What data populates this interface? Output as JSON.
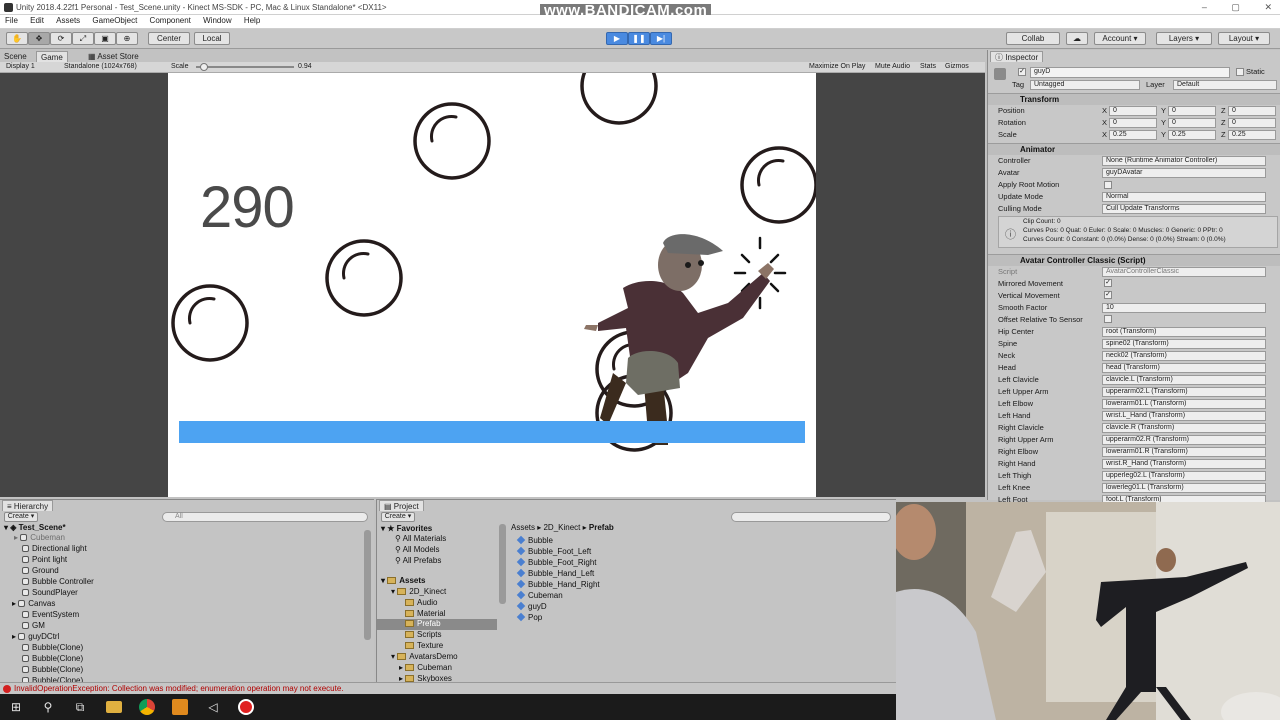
{
  "window": {
    "title": "Unity 2018.4.22f1 Personal - Test_Scene.unity - Kinect MS-SDK - PC, Mac & Linux Standalone* <DX11>",
    "watermark": "www.BANDICAM.com",
    "controls": [
      "–",
      "▢",
      "✕"
    ]
  },
  "menu": [
    "File",
    "Edit",
    "Assets",
    "GameObject",
    "Component",
    "Window",
    "Help"
  ],
  "toolbar": {
    "pivot": "Center",
    "space": "Local",
    "collab": "Collab",
    "account": "Account",
    "layers": "Layers",
    "layout": "Layout"
  },
  "tabs": {
    "scene": "Scene",
    "game": "Game",
    "asset_store": "Asset Store",
    "inspector": "Inspector",
    "hierarchy": "Hierarchy",
    "project": "Project"
  },
  "game_bar": {
    "display": "Display 1",
    "resolution": "Standalone (1024x768)",
    "scale_label": "Scale",
    "scale_value": "0.94",
    "maximize": "Maximize On Play",
    "mute": "Mute Audio",
    "stats": "Stats",
    "gizmos": "Gizmos"
  },
  "game": {
    "score": "290"
  },
  "inspector": {
    "object_name": "guyD",
    "static_label": "Static",
    "tag_label": "Tag",
    "tag_value": "Untagged",
    "layer_label": "Layer",
    "layer_value": "Default",
    "transform": {
      "title": "Transform",
      "rows": [
        {
          "label": "Position",
          "x": "0",
          "y": "0",
          "z": "0"
        },
        {
          "label": "Rotation",
          "x": "0",
          "y": "0",
          "z": "0"
        },
        {
          "label": "Scale",
          "x": "0.25",
          "y": "0.25",
          "z": "0.25"
        }
      ]
    },
    "animator": {
      "title": "Animator",
      "rows": [
        {
          "label": "Controller",
          "value": "None (Runtime Animator Controller)"
        },
        {
          "label": "Avatar",
          "value": "guyDAvatar"
        },
        {
          "label": "Apply Root Motion",
          "value": ""
        },
        {
          "label": "Update Mode",
          "value": "Normal"
        },
        {
          "label": "Culling Mode",
          "value": "Cull Update Transforms"
        }
      ],
      "info1": "Clip Count: 0",
      "info2": "Curves Pos: 0 Quat: 0 Euler: 0 Scale: 0 Muscles: 0 Generic: 0 PPtr: 0",
      "info3": "Curves Count: 0 Constant: 0 (0.0%) Dense: 0 (0.0%) Stream: 0 (0.0%)"
    },
    "script": {
      "title": "Avatar Controller Classic (Script)",
      "script_label": "Script",
      "script_value": "AvatarControllerClassic",
      "mirrored": "Mirrored Movement",
      "vertical": "Vertical Movement",
      "smooth_label": "Smooth Factor",
      "smooth_value": "10",
      "offset": "Offset Relative To Sensor",
      "bones": [
        {
          "label": "Hip Center",
          "value": "root (Transform)"
        },
        {
          "label": "Spine",
          "value": "spine02 (Transform)"
        },
        {
          "label": "Neck",
          "value": "neck02 (Transform)"
        },
        {
          "label": "Head",
          "value": "head (Transform)"
        },
        {
          "label": "Left Clavicle",
          "value": "clavicle.L (Transform)"
        },
        {
          "label": "Left Upper Arm",
          "value": "upperarm02.L (Transform)"
        },
        {
          "label": "Left Elbow",
          "value": "lowerarm01.L (Transform)"
        },
        {
          "label": "Left Hand",
          "value": "wrist.L_Hand (Transform)"
        },
        {
          "label": "Right Clavicle",
          "value": "clavicle.R (Transform)"
        },
        {
          "label": "Right Upper Arm",
          "value": "upperarm02.R (Transform)"
        },
        {
          "label": "Right Elbow",
          "value": "lowerarm01.R (Transform)"
        },
        {
          "label": "Right Hand",
          "value": "wrist.R_Hand (Transform)"
        },
        {
          "label": "Left Thigh",
          "value": "upperleg02.L (Transform)"
        },
        {
          "label": "Left Knee",
          "value": "lowerleg01.L (Transform)"
        },
        {
          "label": "Left Foot",
          "value": "foot.L (Transform)"
        }
      ]
    }
  },
  "hierarchy": {
    "create": "Create",
    "search_placeholder": "All",
    "scene": "Test_Scene*",
    "items": [
      "Cubeman",
      "Directional light",
      "Point light",
      "Ground",
      "Bubble Controller",
      "SoundPlayer",
      "Canvas",
      "EventSystem",
      "GM",
      "guyDCtrl",
      "Bubble(Clone)",
      "Bubble(Clone)",
      "Bubble(Clone)",
      "Bubble(Clone)"
    ]
  },
  "project": {
    "create": "Create",
    "favorites": "Favorites",
    "fav_items": [
      "All Materials",
      "All Models",
      "All Prefabs"
    ],
    "assets": "Assets",
    "tree": [
      "2D_Kinect",
      "Audio",
      "Material",
      "Prefab",
      "Scripts",
      "Texture",
      "AvatarsDemo",
      "Cubeman",
      "Skyboxes"
    ],
    "breadcrumb": [
      "Assets",
      "2D_Kinect",
      "Prefab"
    ],
    "files": [
      "Bubble",
      "Bubble_Foot_Left",
      "Bubble_Foot_Right",
      "Bubble_Hand_Left",
      "Bubble_Hand_Right",
      "Cubeman",
      "guyD",
      "Pop"
    ]
  },
  "status": {
    "message": "InvalidOperationException: Collection was modified; enumeration operation may not execute."
  },
  "colors": {
    "accent": "#4da3f2",
    "play_active": "#4a8ae0"
  }
}
